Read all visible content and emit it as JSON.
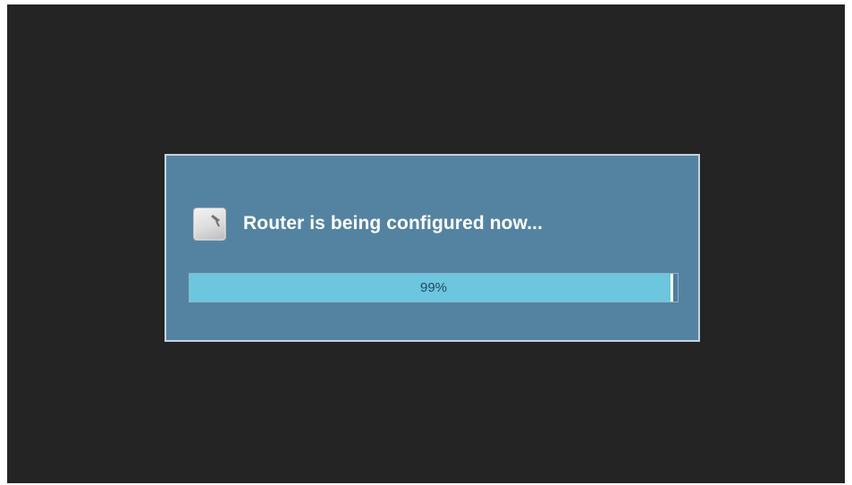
{
  "dialog": {
    "message": "Router is being configured now...",
    "icon": "router-icon",
    "progress": {
      "value": 0.99,
      "label": "99%"
    }
  },
  "colors": {
    "background": "#242424",
    "dialog_background": "#5483a2",
    "dialog_border": "#c5d3e2",
    "progress_fill": "#6cc6de",
    "progress_label": "#234a62"
  }
}
